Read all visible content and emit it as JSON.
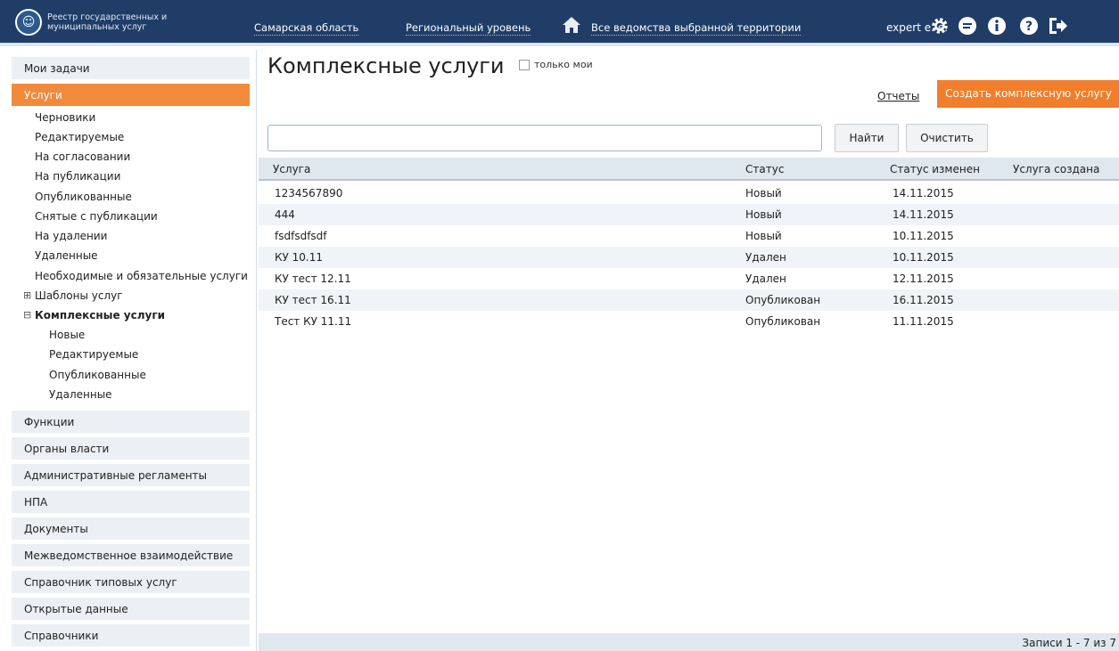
{
  "header": {
    "logo_text": "Реестр государственных и муниципальных услуг",
    "region": "Самарская область",
    "level": "Региональный уровень",
    "agencies": "Все ведомства выбранной территории",
    "user": "expert e. e."
  },
  "sidebar": {
    "sections_top": [
      {
        "label": "Мои задачи"
      },
      {
        "label": "Услуги"
      }
    ],
    "services_sub": [
      "Черновики",
      "Редактируемые",
      "На согласовании",
      "На публикации",
      "Опубликованные",
      "Снятые с публикации",
      "На удалении",
      "Удаленные",
      "Необходимые и обязательные услуги"
    ],
    "templates": "Шаблоны услуг",
    "complex": "Комплексные услуги",
    "complex_sub": [
      "Новые",
      "Редактируемые",
      "Опубликованные",
      "Удаленные"
    ],
    "sections_bottom": [
      "Функции",
      "Органы власти",
      "Административные регламенты",
      "НПА",
      "Документы",
      "Межведомственное взаимодействие",
      "Справочник типовых услуг",
      "Открытые данные",
      "Справочники"
    ]
  },
  "main": {
    "title": "Комплексные услуги",
    "only_mine": "только мои",
    "reports": "Отчеты",
    "create_button": "Создать комплексную услугу",
    "search_placeholder": "",
    "find_button": "Найти",
    "clear_button": "Очистить",
    "columns": [
      "Услуга",
      "Статус",
      "Статус изменен",
      "Услуга создана"
    ],
    "rows": [
      {
        "name": "1234567890",
        "status": "Новый",
        "changed": "14.11.2015",
        "created": ""
      },
      {
        "name": "444",
        "status": "Новый",
        "changed": "14.11.2015",
        "created": ""
      },
      {
        "name": "fsdfsdfsdf",
        "status": "Новый",
        "changed": "10.11.2015",
        "created": ""
      },
      {
        "name": "КУ 10.11",
        "status": "Удален",
        "changed": "10.11.2015",
        "created": ""
      },
      {
        "name": "КУ тест 12.11",
        "status": "Удален",
        "changed": "12.11.2015",
        "created": ""
      },
      {
        "name": "КУ тест 16.11",
        "status": "Опубликован",
        "changed": "16.11.2015",
        "created": ""
      },
      {
        "name": "Тест КУ 11.11",
        "status": "Опубликован",
        "changed": "11.11.2015",
        "created": ""
      }
    ],
    "records": "Записи 1 - 7 из 7"
  },
  "colors": {
    "header_bg": "#1f3d67",
    "accent": "#f07e2b",
    "active_section": "#f28a3c"
  },
  "icons": [
    "home-icon",
    "settings-icon",
    "chat-icon",
    "info-icon",
    "help-icon",
    "logout-icon"
  ]
}
